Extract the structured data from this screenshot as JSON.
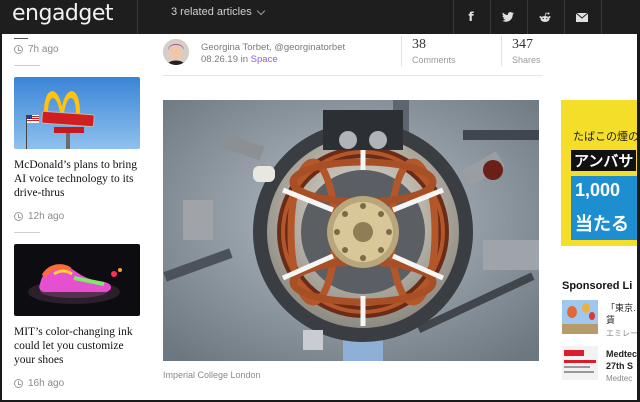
{
  "header": {
    "logo": "engadget",
    "related_label": "3 related articles",
    "social_icons": [
      "facebook-icon",
      "twitter-icon",
      "reddit-icon",
      "email-icon"
    ]
  },
  "sidebar": {
    "items": [
      {
        "time": "7h ago"
      },
      {
        "title": "McDonald’s plans to bring AI voice technology to its drive-thrus",
        "time": "12h ago",
        "image": "mcdonalds-sign"
      },
      {
        "title": "MIT’s color-changing ink could let you customize your shoes",
        "time": "16h ago",
        "image": "color-changing-shoe"
      }
    ]
  },
  "article": {
    "author": "Georgina Torbet, @georginatorbet",
    "date": "08.26.19",
    "in_label": "in",
    "category": "Space",
    "comments_count": "38",
    "comments_label": "Comments",
    "shares_count": "347",
    "shares_label": "Shares",
    "image_caption": "Imperial College London",
    "accent_color": "#9b59d0"
  },
  "right": {
    "ad": {
      "line1": "たばこの煙の",
      "line2": "アンバサ",
      "line3": "1,000",
      "line4": "当たる",
      "bg_color": "#f4de2a",
      "blue_color": "#1d8fd0"
    },
    "sponsored_heading": "Sponsored Li",
    "sponsored_items": [
      {
        "title": "「東京…",
        "subtitle": "",
        "title_line2": "賃",
        "source": "エミレー"
      },
      {
        "title": "Medtec",
        "title_line2": "27th S",
        "source": "Medtec"
      }
    ]
  }
}
